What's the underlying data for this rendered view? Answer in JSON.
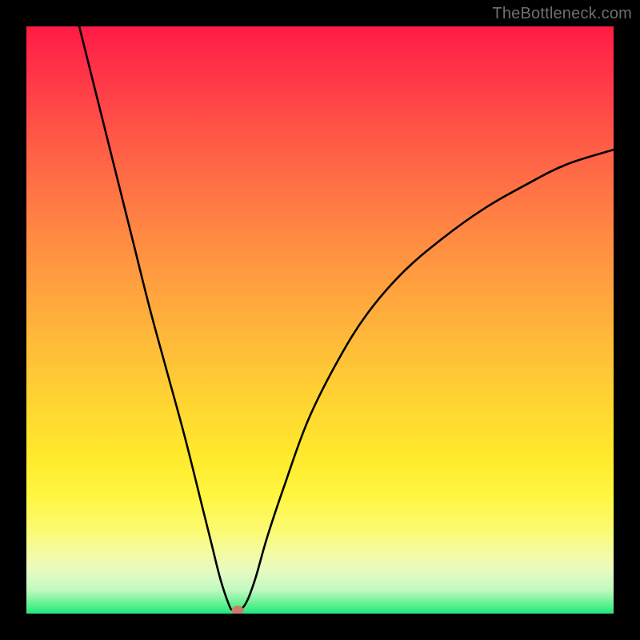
{
  "watermark": "TheBottleneck.com",
  "chart_data": {
    "type": "line",
    "title": "",
    "xlabel": "",
    "ylabel": "",
    "xlim": [
      0,
      100
    ],
    "ylim": [
      0,
      100
    ],
    "grid": false,
    "series": [
      {
        "name": "bottleneck-curve",
        "x": [
          9,
          12,
          15,
          18,
          21,
          24,
          27,
          30,
          31.5,
          33,
          34.5,
          35.2,
          36.2,
          37.5,
          39,
          41,
          44,
          48,
          53,
          58,
          64,
          71,
          78,
          85,
          92,
          100
        ],
        "values": [
          100,
          88,
          76,
          64,
          52,
          41,
          30,
          18,
          12,
          6,
          1.5,
          0.5,
          0.5,
          2,
          6,
          13,
          22,
          33,
          43,
          51,
          58,
          64,
          69,
          73,
          76.5,
          79
        ]
      }
    ],
    "annotations": [
      {
        "name": "optimum-marker",
        "x": 36,
        "y": 0.5
      }
    ],
    "background": {
      "type": "vertical-gradient",
      "stops": [
        {
          "pos": 0.0,
          "color": "#ff1a46"
        },
        {
          "pos": 0.32,
          "color": "#ff7f44"
        },
        {
          "pos": 0.63,
          "color": "#ffd233"
        },
        {
          "pos": 0.86,
          "color": "#fbfb73"
        },
        {
          "pos": 1.0,
          "color": "#22e682"
        }
      ]
    }
  }
}
